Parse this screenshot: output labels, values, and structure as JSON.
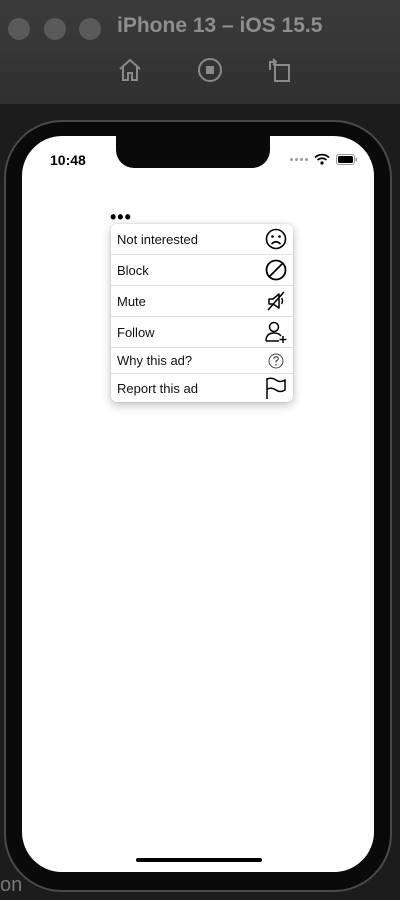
{
  "window": {
    "title": "iPhone 13 – iOS 15.5",
    "toolbar": {
      "home_icon": "home-icon",
      "screenshot_icon": "stop-icon",
      "rotate_icon": "rotate-icon"
    }
  },
  "backdrop": {
    "left_text": "on"
  },
  "status_bar": {
    "time": "10:48"
  },
  "more_button": {
    "label": "•••"
  },
  "menu": {
    "items": [
      {
        "label": "Not interested",
        "icon": "sad-face-icon"
      },
      {
        "label": "Block",
        "icon": "block-icon"
      },
      {
        "label": "Mute",
        "icon": "mute-icon"
      },
      {
        "label": "Follow",
        "icon": "follow-user-icon"
      },
      {
        "label": "Why this ad?",
        "icon": "question-icon"
      },
      {
        "label": "Report this ad",
        "icon": "flag-icon"
      }
    ]
  }
}
